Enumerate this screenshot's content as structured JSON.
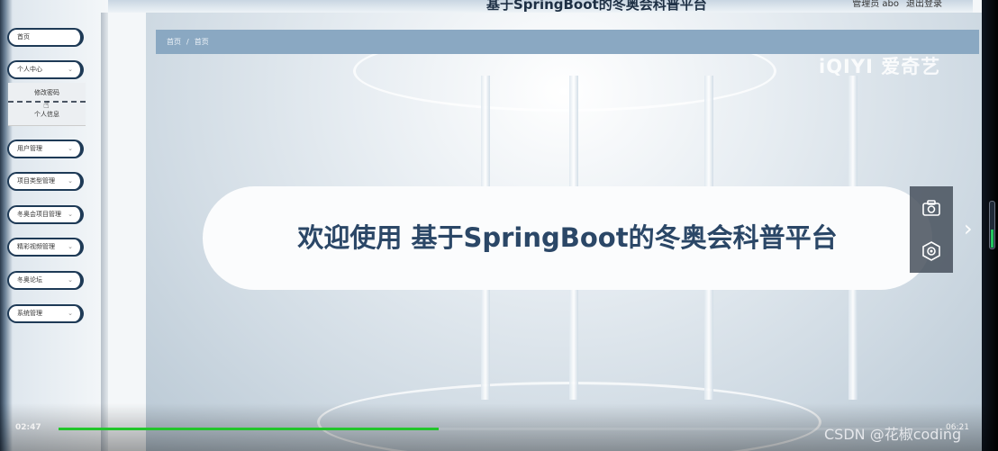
{
  "app": {
    "title": "基于SpringBoot的冬奥会科普平台",
    "user_label": "管理员 abo",
    "logout_label": "退出登录"
  },
  "sidebar": {
    "items": [
      {
        "label": "首页",
        "chevron": ""
      },
      {
        "label": "个人中心",
        "chevron": "⌄"
      },
      {
        "label": "用户管理",
        "chevron": "⌄"
      },
      {
        "label": "项目类型管理",
        "chevron": "⌄"
      },
      {
        "label": "冬奥会项目管理",
        "chevron": "⌄"
      },
      {
        "label": "精彩视频管理",
        "chevron": "⌄"
      },
      {
        "label": "冬奥论坛",
        "chevron": "⌄"
      },
      {
        "label": "系统管理",
        "chevron": "⌄"
      }
    ],
    "submenu": [
      {
        "label": "修改密码"
      },
      {
        "label": "个人信息"
      }
    ]
  },
  "breadcrumb": {
    "home": "首页",
    "separator": "/",
    "current": "首页"
  },
  "welcome": {
    "text": "欢迎使用 基于SpringBoot的冬奥会科普平台"
  },
  "video_overlay": {
    "logo": "iQIYI 爱奇艺",
    "time_current": "02:47",
    "time_total": "06:21",
    "progress": 0.42,
    "watermark": "CSDN @花椒coding",
    "camera_icon": "camera-icon",
    "settings_icon": "gear-icon",
    "next_icon": "chevron-right-icon"
  },
  "colors": {
    "accent": "#1e3a56",
    "breadcrumb_bg": "#8aa8c2",
    "welcome_text": "#2b4767",
    "progress": "#22c52b"
  }
}
